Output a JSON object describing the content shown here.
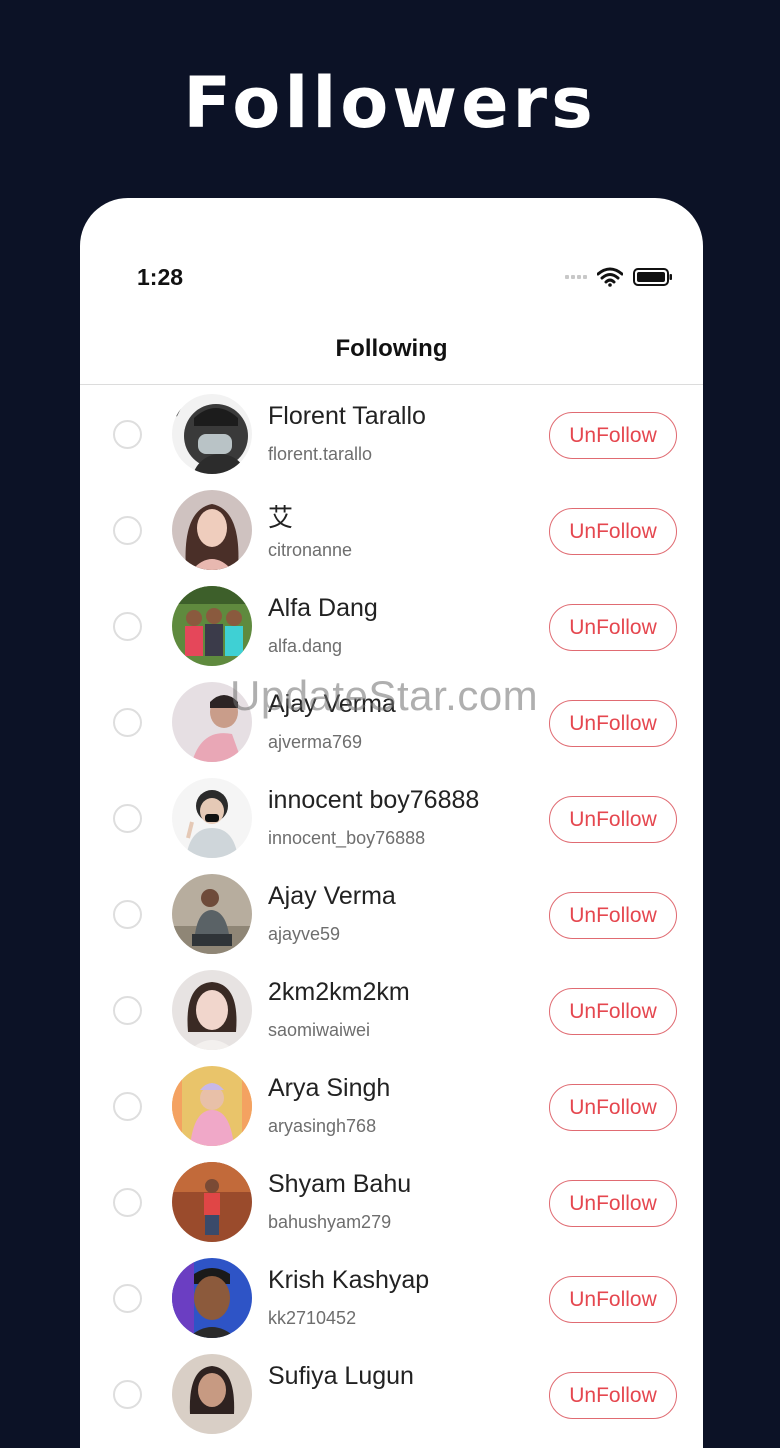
{
  "promo": {
    "title": "Followers"
  },
  "status_bar": {
    "time": "1:28"
  },
  "nav": {
    "title": "Following"
  },
  "watermark": "UpdateStar.com",
  "colors": {
    "background": "#0c1226",
    "accent": "#e5474f"
  },
  "rows": [
    {
      "name": "Florent Tarallo",
      "handle": "florent.tarallo",
      "button": "UnFollow"
    },
    {
      "name": "艾",
      "handle": "citronanne",
      "button": "UnFollow"
    },
    {
      "name": "Alfa Dang",
      "handle": "alfa.dang",
      "button": "UnFollow"
    },
    {
      "name": "Ajay Verma",
      "handle": "ajverma769",
      "button": "UnFollow"
    },
    {
      "name": "innocent boy76888",
      "handle": "innocent_boy76888",
      "button": "UnFollow"
    },
    {
      "name": "Ajay Verma",
      "handle": "ajayve59",
      "button": "UnFollow"
    },
    {
      "name": "2km2km2km",
      "handle": "saomiwaiwei",
      "button": "UnFollow"
    },
    {
      "name": "Arya Singh",
      "handle": "aryasingh768",
      "button": "UnFollow"
    },
    {
      "name": "Shyam Bahu",
      "handle": "bahushyam279",
      "button": "UnFollow"
    },
    {
      "name": "Krish Kashyap",
      "handle": "kk2710452",
      "button": "UnFollow"
    },
    {
      "name": "Sufiya Lugun",
      "handle": "",
      "button": "UnFollow"
    }
  ]
}
